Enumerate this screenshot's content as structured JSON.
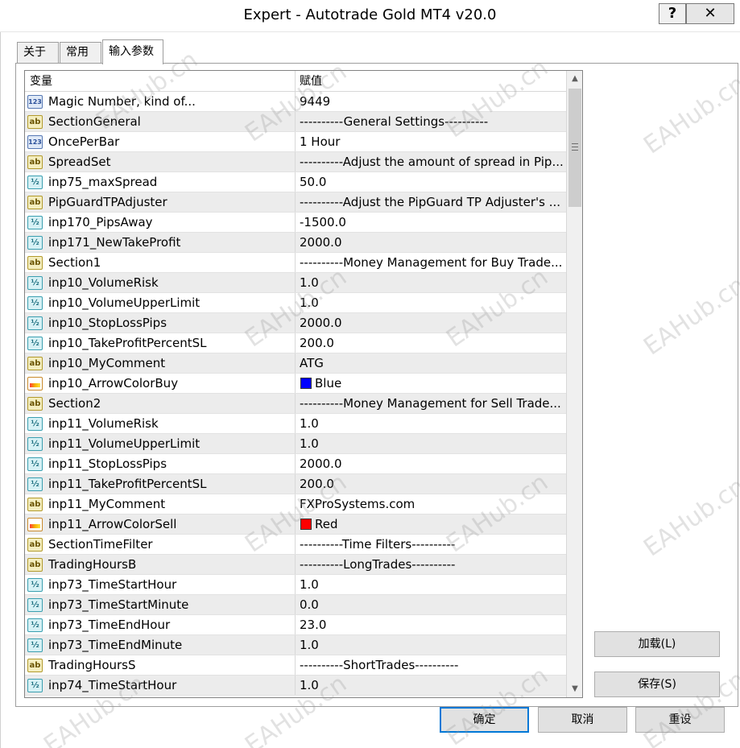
{
  "window": {
    "title": "Expert - Autotrade Gold MT4 v20.0",
    "help_label": "?",
    "close_label": "✕"
  },
  "tabs": [
    {
      "label": "关于"
    },
    {
      "label": "常用"
    },
    {
      "label": "输入参数"
    }
  ],
  "grid": {
    "header": {
      "variable": "变量",
      "value": "赋值"
    },
    "rows": [
      {
        "type": "int",
        "icon_text": "123",
        "name": "Magic Number, kind of...",
        "value": "9449"
      },
      {
        "type": "str",
        "icon_text": "ab",
        "name": "SectionGeneral",
        "value": "----------General Settings----------"
      },
      {
        "type": "int",
        "icon_text": "123",
        "name": "OncePerBar",
        "value": "1 Hour"
      },
      {
        "type": "str",
        "icon_text": "ab",
        "name": "SpreadSet",
        "value": "----------Adjust the amount of spread in Pip..."
      },
      {
        "type": "dbl",
        "icon_text": "½",
        "name": "inp75_maxSpread",
        "value": "50.0"
      },
      {
        "type": "str",
        "icon_text": "ab",
        "name": "PipGuardTPAdjuster",
        "value": "----------Adjust the PipGuard TP Adjuster's ..."
      },
      {
        "type": "dbl",
        "icon_text": "½",
        "name": "inp170_PipsAway",
        "value": "-1500.0"
      },
      {
        "type": "dbl",
        "icon_text": "½",
        "name": "inp171_NewTakeProfit",
        "value": "2000.0"
      },
      {
        "type": "str",
        "icon_text": "ab",
        "name": "Section1",
        "value": "----------Money Management for Buy Trade..."
      },
      {
        "type": "dbl",
        "icon_text": "½",
        "name": "inp10_VolumeRisk",
        "value": "1.0"
      },
      {
        "type": "dbl",
        "icon_text": "½",
        "name": "inp10_VolumeUpperLimit",
        "value": "1.0"
      },
      {
        "type": "dbl",
        "icon_text": "½",
        "name": "inp10_StopLossPips",
        "value": "2000.0"
      },
      {
        "type": "dbl",
        "icon_text": "½",
        "name": "inp10_TakeProfitPercentSL",
        "value": "200.0"
      },
      {
        "type": "str",
        "icon_text": "ab",
        "name": "inp10_MyComment",
        "value": "ATG"
      },
      {
        "type": "col",
        "icon_text": "",
        "name": "inp10_ArrowColorBuy",
        "value": "Blue",
        "swatch": "#0000ff"
      },
      {
        "type": "str",
        "icon_text": "ab",
        "name": "Section2",
        "value": "----------Money Management for Sell Trade..."
      },
      {
        "type": "dbl",
        "icon_text": "½",
        "name": "inp11_VolumeRisk",
        "value": "1.0"
      },
      {
        "type": "dbl",
        "icon_text": "½",
        "name": "inp11_VolumeUpperLimit",
        "value": "1.0"
      },
      {
        "type": "dbl",
        "icon_text": "½",
        "name": "inp11_StopLossPips",
        "value": "2000.0"
      },
      {
        "type": "dbl",
        "icon_text": "½",
        "name": "inp11_TakeProfitPercentSL",
        "value": "200.0"
      },
      {
        "type": "str",
        "icon_text": "ab",
        "name": "inp11_MyComment",
        "value": "FXProSystems.com"
      },
      {
        "type": "col",
        "icon_text": "",
        "name": "inp11_ArrowColorSell",
        "value": "Red",
        "swatch": "#ff0000"
      },
      {
        "type": "str",
        "icon_text": "ab",
        "name": "SectionTimeFilter",
        "value": "----------Time Filters----------"
      },
      {
        "type": "str",
        "icon_text": "ab",
        "name": "TradingHoursB",
        "value": "----------LongTrades----------"
      },
      {
        "type": "dbl",
        "icon_text": "½",
        "name": "inp73_TimeStartHour",
        "value": "1.0"
      },
      {
        "type": "dbl",
        "icon_text": "½",
        "name": "inp73_TimeStartMinute",
        "value": "0.0"
      },
      {
        "type": "dbl",
        "icon_text": "½",
        "name": "inp73_TimeEndHour",
        "value": "23.0"
      },
      {
        "type": "dbl",
        "icon_text": "½",
        "name": "inp73_TimeEndMinute",
        "value": "1.0"
      },
      {
        "type": "str",
        "icon_text": "ab",
        "name": "TradingHoursS",
        "value": "----------ShortTrades----------"
      },
      {
        "type": "dbl",
        "icon_text": "½",
        "name": "inp74_TimeStartHour",
        "value": "1.0"
      }
    ]
  },
  "scrollbar": {
    "up_icon": "▲",
    "down_icon": "▼"
  },
  "buttons": {
    "load": "加载(L)",
    "save": "保存(S)",
    "ok": "确定",
    "cancel": "取消",
    "reset": "重设"
  },
  "watermark": "EAHub.cn"
}
